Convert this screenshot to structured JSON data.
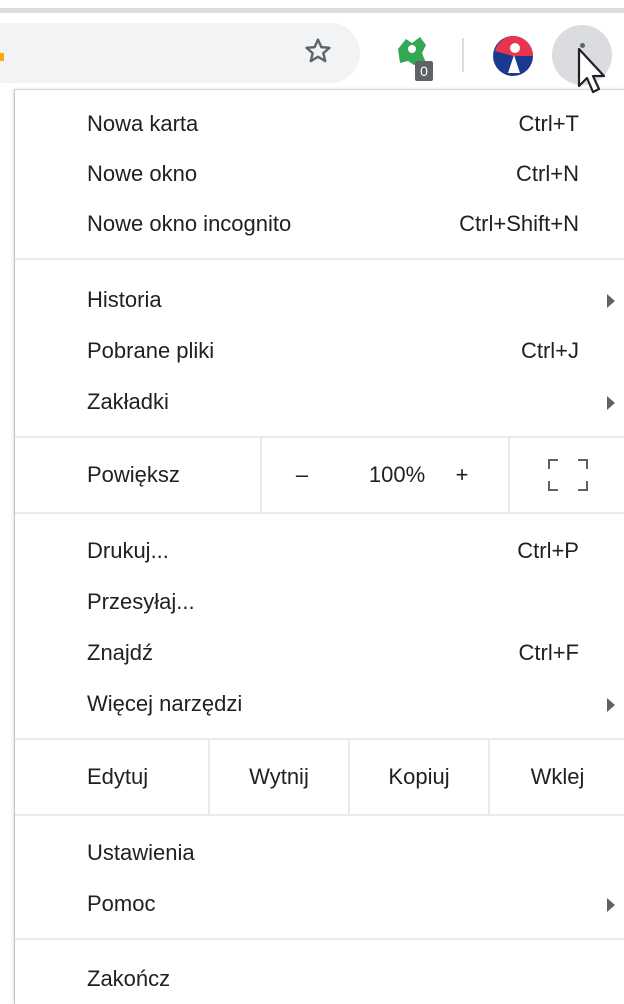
{
  "toolbar": {
    "extension_badge": "0",
    "icons": [
      "star-icon",
      "extension-green-icon",
      "extension-avatar-icon",
      "more-vert-icon",
      "cursor-icon"
    ]
  },
  "menu": {
    "group1": [
      {
        "label": "Nowa karta",
        "shortcut": "Ctrl+T"
      },
      {
        "label": "Nowe okno",
        "shortcut": "Ctrl+N"
      },
      {
        "label": "Nowe okno incognito",
        "shortcut": "Ctrl+Shift+N"
      }
    ],
    "group2": [
      {
        "label": "Historia",
        "shortcut": ""
      },
      {
        "label": "Pobrane pliki",
        "shortcut": "Ctrl+J"
      },
      {
        "label": "Zakładki",
        "shortcut": ""
      }
    ],
    "zoom": {
      "label": "Powiększ",
      "minus": "–",
      "value": "100%",
      "plus": "+"
    },
    "group3": [
      {
        "label": "Drukuj...",
        "shortcut": "Ctrl+P"
      },
      {
        "label": "Przesyłaj...",
        "shortcut": ""
      },
      {
        "label": "Znajdź",
        "shortcut": "Ctrl+F"
      },
      {
        "label": "Więcej narzędzi",
        "shortcut": ""
      }
    ],
    "edit": {
      "label": "Edytuj",
      "cut": "Wytnij",
      "copy": "Kopiuj",
      "paste": "Wklej"
    },
    "group4": [
      {
        "label": "Ustawienia"
      },
      {
        "label": "Pomoc"
      }
    ],
    "exit": {
      "label": "Zakończ"
    }
  },
  "colors": {
    "menu_text": "#202124",
    "divider": "#e8eaed",
    "toolbar_button": "#dadce0",
    "extension_green": "#34a853"
  }
}
